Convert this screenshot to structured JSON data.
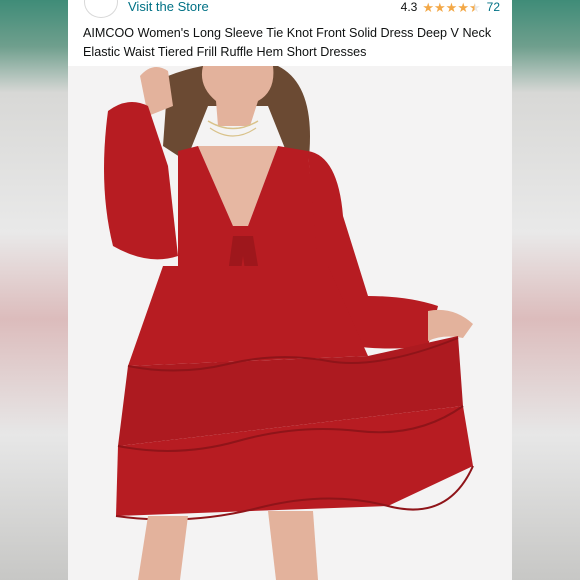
{
  "store": {
    "link_text": "Visit the Store"
  },
  "rating": {
    "value": "4.3",
    "stars": "4.3",
    "count": "72"
  },
  "product": {
    "title": "AIMCOO Women's Long Sleeve Tie Knot Front Solid Dress Deep V Neck Elastic Waist Tiered Frill Ruffle Hem Short Dresses"
  },
  "colors": {
    "link": "#007185",
    "star": "#f3a847",
    "dress": "#b71c22"
  },
  "icons": {
    "star": "star-icon",
    "half_star": "half-star-icon"
  }
}
